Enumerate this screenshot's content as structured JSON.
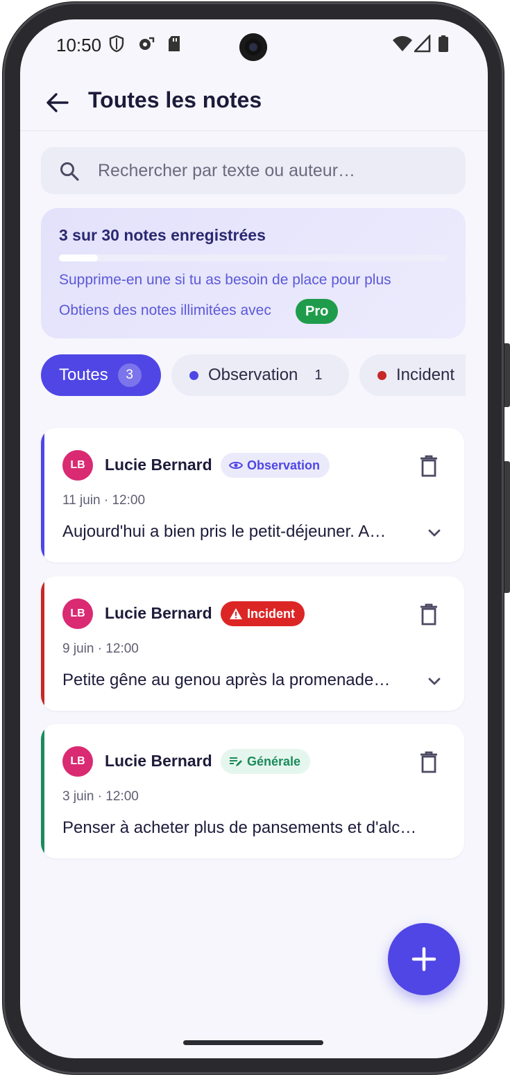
{
  "status_bar": {
    "time": "10:50"
  },
  "header": {
    "title": "Toutes les notes"
  },
  "search": {
    "placeholder": "Rechercher par texte ou auteur…"
  },
  "quota": {
    "title": "3 sur 30 notes enregistrées",
    "used": 3,
    "limit": 30,
    "message": "Supprime-en une si tu as besoin de place pour plus",
    "pro_line": "Obtiens des notes illimitées avec",
    "pro_badge": "Pro"
  },
  "filters": [
    {
      "label": "Toutes",
      "count": "3",
      "active": true
    },
    {
      "label": "Observation",
      "count": "1",
      "active": false,
      "dot_color": "#4f46e5"
    },
    {
      "label": "Incident",
      "active": false,
      "dot_color": "#c62828"
    }
  ],
  "notes": [
    {
      "initials": "LB",
      "author": "Lucie Bernard",
      "tag": "Observation",
      "tag_icon": "eye-icon",
      "accent": "#4f46e5",
      "date": "11 juin · 12:00",
      "text": "Aujourd'hui a bien pris le petit-déjeuner. A…"
    },
    {
      "initials": "LB",
      "author": "Lucie Bernard",
      "tag": "Incident",
      "tag_icon": "warning-icon",
      "accent": "#c62828",
      "date": "9 juin · 12:00",
      "text": "Petite gêne au genou après la promenade…"
    },
    {
      "initials": "LB",
      "author": "Lucie Bernard",
      "tag": "Générale",
      "tag_icon": "edit-note-icon",
      "accent": "#1b8a5a",
      "date": "3 juin · 12:00",
      "text": "Penser à acheter plus de pansements et d'alc…"
    }
  ],
  "colors": {
    "primary": "#4f46e5",
    "pro_green": "#1f9c4b",
    "incident_red": "#dc2626",
    "general_green": "#1b8a5a"
  }
}
